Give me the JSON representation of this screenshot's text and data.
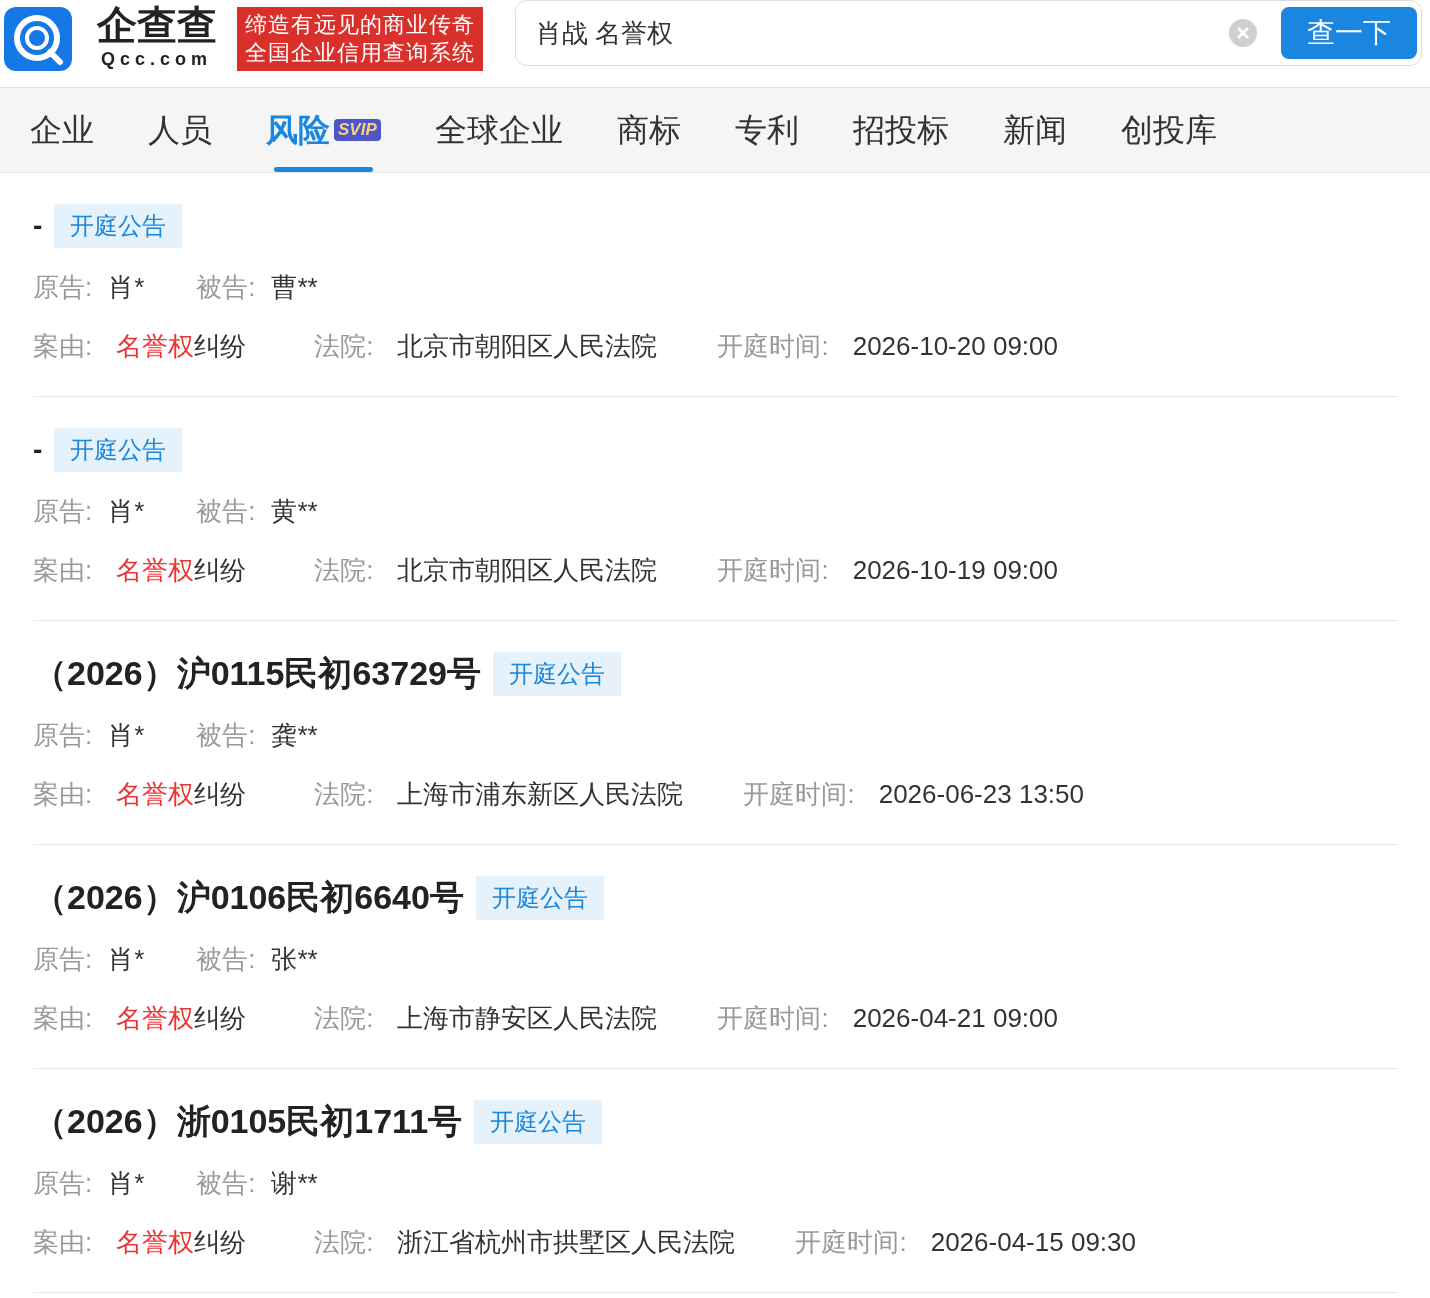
{
  "header": {
    "logo_name": "企查查",
    "logo_domain": "Qcc.com",
    "slogan_lines": [
      "缔造有远见的商业传奇",
      "全国企业信用查询系统"
    ],
    "search": {
      "value": "肖战 名誉权"
    },
    "search_button": "查一下"
  },
  "tabs": [
    {
      "label": "企业",
      "selected": false
    },
    {
      "label": "人员",
      "selected": false
    },
    {
      "label": "风险",
      "selected": true,
      "badge": "SVIP"
    },
    {
      "label": "全球企业",
      "selected": false
    },
    {
      "label": "商标",
      "selected": false
    },
    {
      "label": "专利",
      "selected": false
    },
    {
      "label": "招投标",
      "selected": false
    },
    {
      "label": "新闻",
      "selected": false
    },
    {
      "label": "创投库",
      "selected": false
    }
  ],
  "cases": [
    {
      "title": "-",
      "tag": "开庭公告",
      "plaintiff_label": "原告:",
      "plaintiff": "肖*",
      "defendant_label": "被告:",
      "defendant": "曹**",
      "cause_label": "案由:",
      "cause_highlight": "名誉权",
      "cause_rest": "纠纷",
      "court_label": "法院:",
      "court": "北京市朝阳区人民法院",
      "time_label": "开庭时间:",
      "time": "2026-10-20 09:00"
    },
    {
      "title": "-",
      "tag": "开庭公告",
      "plaintiff_label": "原告:",
      "plaintiff": "肖*",
      "defendant_label": "被告:",
      "defendant": "黄**",
      "cause_label": "案由:",
      "cause_highlight": "名誉权",
      "cause_rest": "纠纷",
      "court_label": "法院:",
      "court": "北京市朝阳区人民法院",
      "time_label": "开庭时间:",
      "time": "2026-10-19 09:00"
    },
    {
      "title": "（2026）沪0115民初63729号",
      "tag": "开庭公告",
      "plaintiff_label": "原告:",
      "plaintiff": "肖*",
      "defendant_label": "被告:",
      "defendant": "龚**",
      "cause_label": "案由:",
      "cause_highlight": "名誉权",
      "cause_rest": "纠纷",
      "court_label": "法院:",
      "court": "上海市浦东新区人民法院",
      "time_label": "开庭时间:",
      "time": "2026-06-23 13:50"
    },
    {
      "title": "（2026）沪0106民初6640号",
      "tag": "开庭公告",
      "plaintiff_label": "原告:",
      "plaintiff": "肖*",
      "defendant_label": "被告:",
      "defendant": "张**",
      "cause_label": "案由:",
      "cause_highlight": "名誉权",
      "cause_rest": "纠纷",
      "court_label": "法院:",
      "court": "上海市静安区人民法院",
      "time_label": "开庭时间:",
      "time": "2026-04-21 09:00"
    },
    {
      "title": "（2026）浙0105民初1711号",
      "tag": "开庭公告",
      "plaintiff_label": "原告:",
      "plaintiff": "肖*",
      "defendant_label": "被告:",
      "defendant": "谢**",
      "cause_label": "案由:",
      "cause_highlight": "名誉权",
      "cause_rest": "纠纷",
      "court_label": "法院:",
      "court": "浙江省杭州市拱墅区人民法院",
      "time_label": "开庭时间:",
      "time": "2026-04-15 09:30"
    }
  ]
}
